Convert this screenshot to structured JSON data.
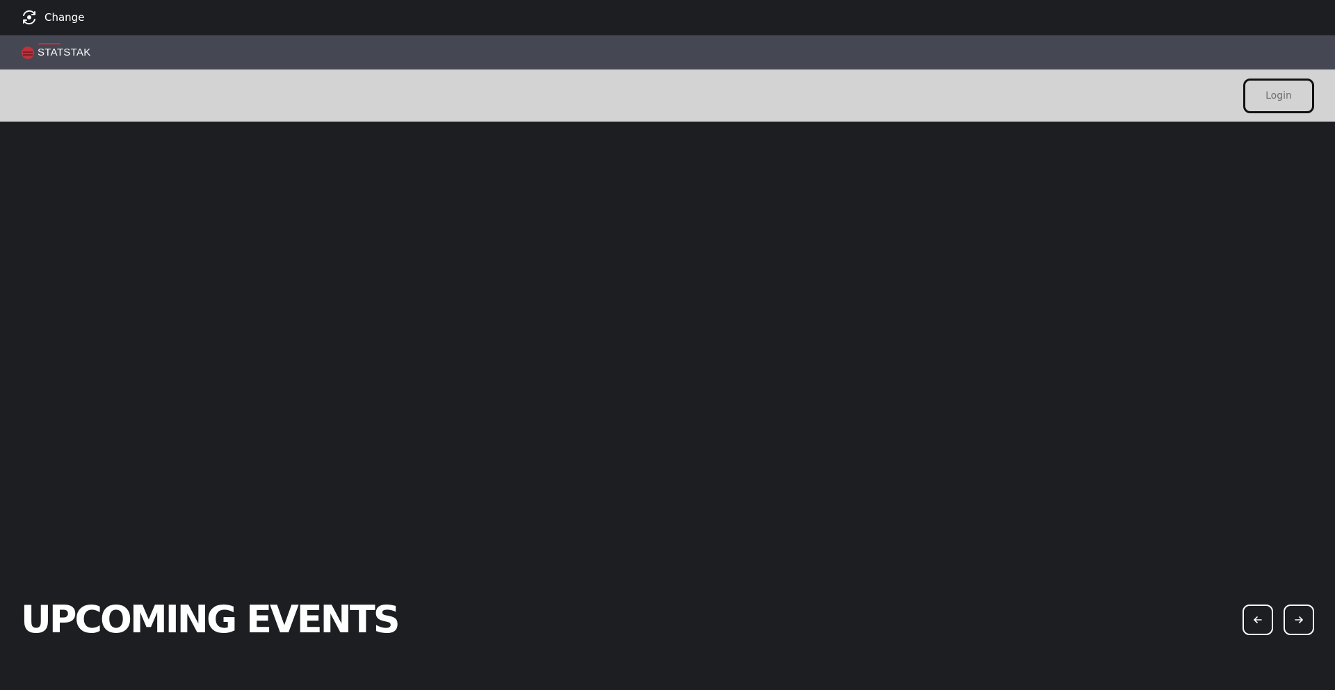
{
  "topbar": {
    "change_label": "Change",
    "change_icon": "swap-cycle-icon"
  },
  "brand": {
    "name": "STATSTAK",
    "logo_icon": "statstak-logo-icon",
    "accent_color": "#c0313b"
  },
  "navbar": {
    "login_label": "Login"
  },
  "events": {
    "title": "UPCOMING EVENTS",
    "prev_icon": "arrow-left-icon",
    "next_icon": "arrow-right-icon"
  },
  "colors": {
    "background": "#1d1e22",
    "brandbar": "#454753",
    "navbar": "#d3d3d3",
    "text": "#ffffff"
  }
}
